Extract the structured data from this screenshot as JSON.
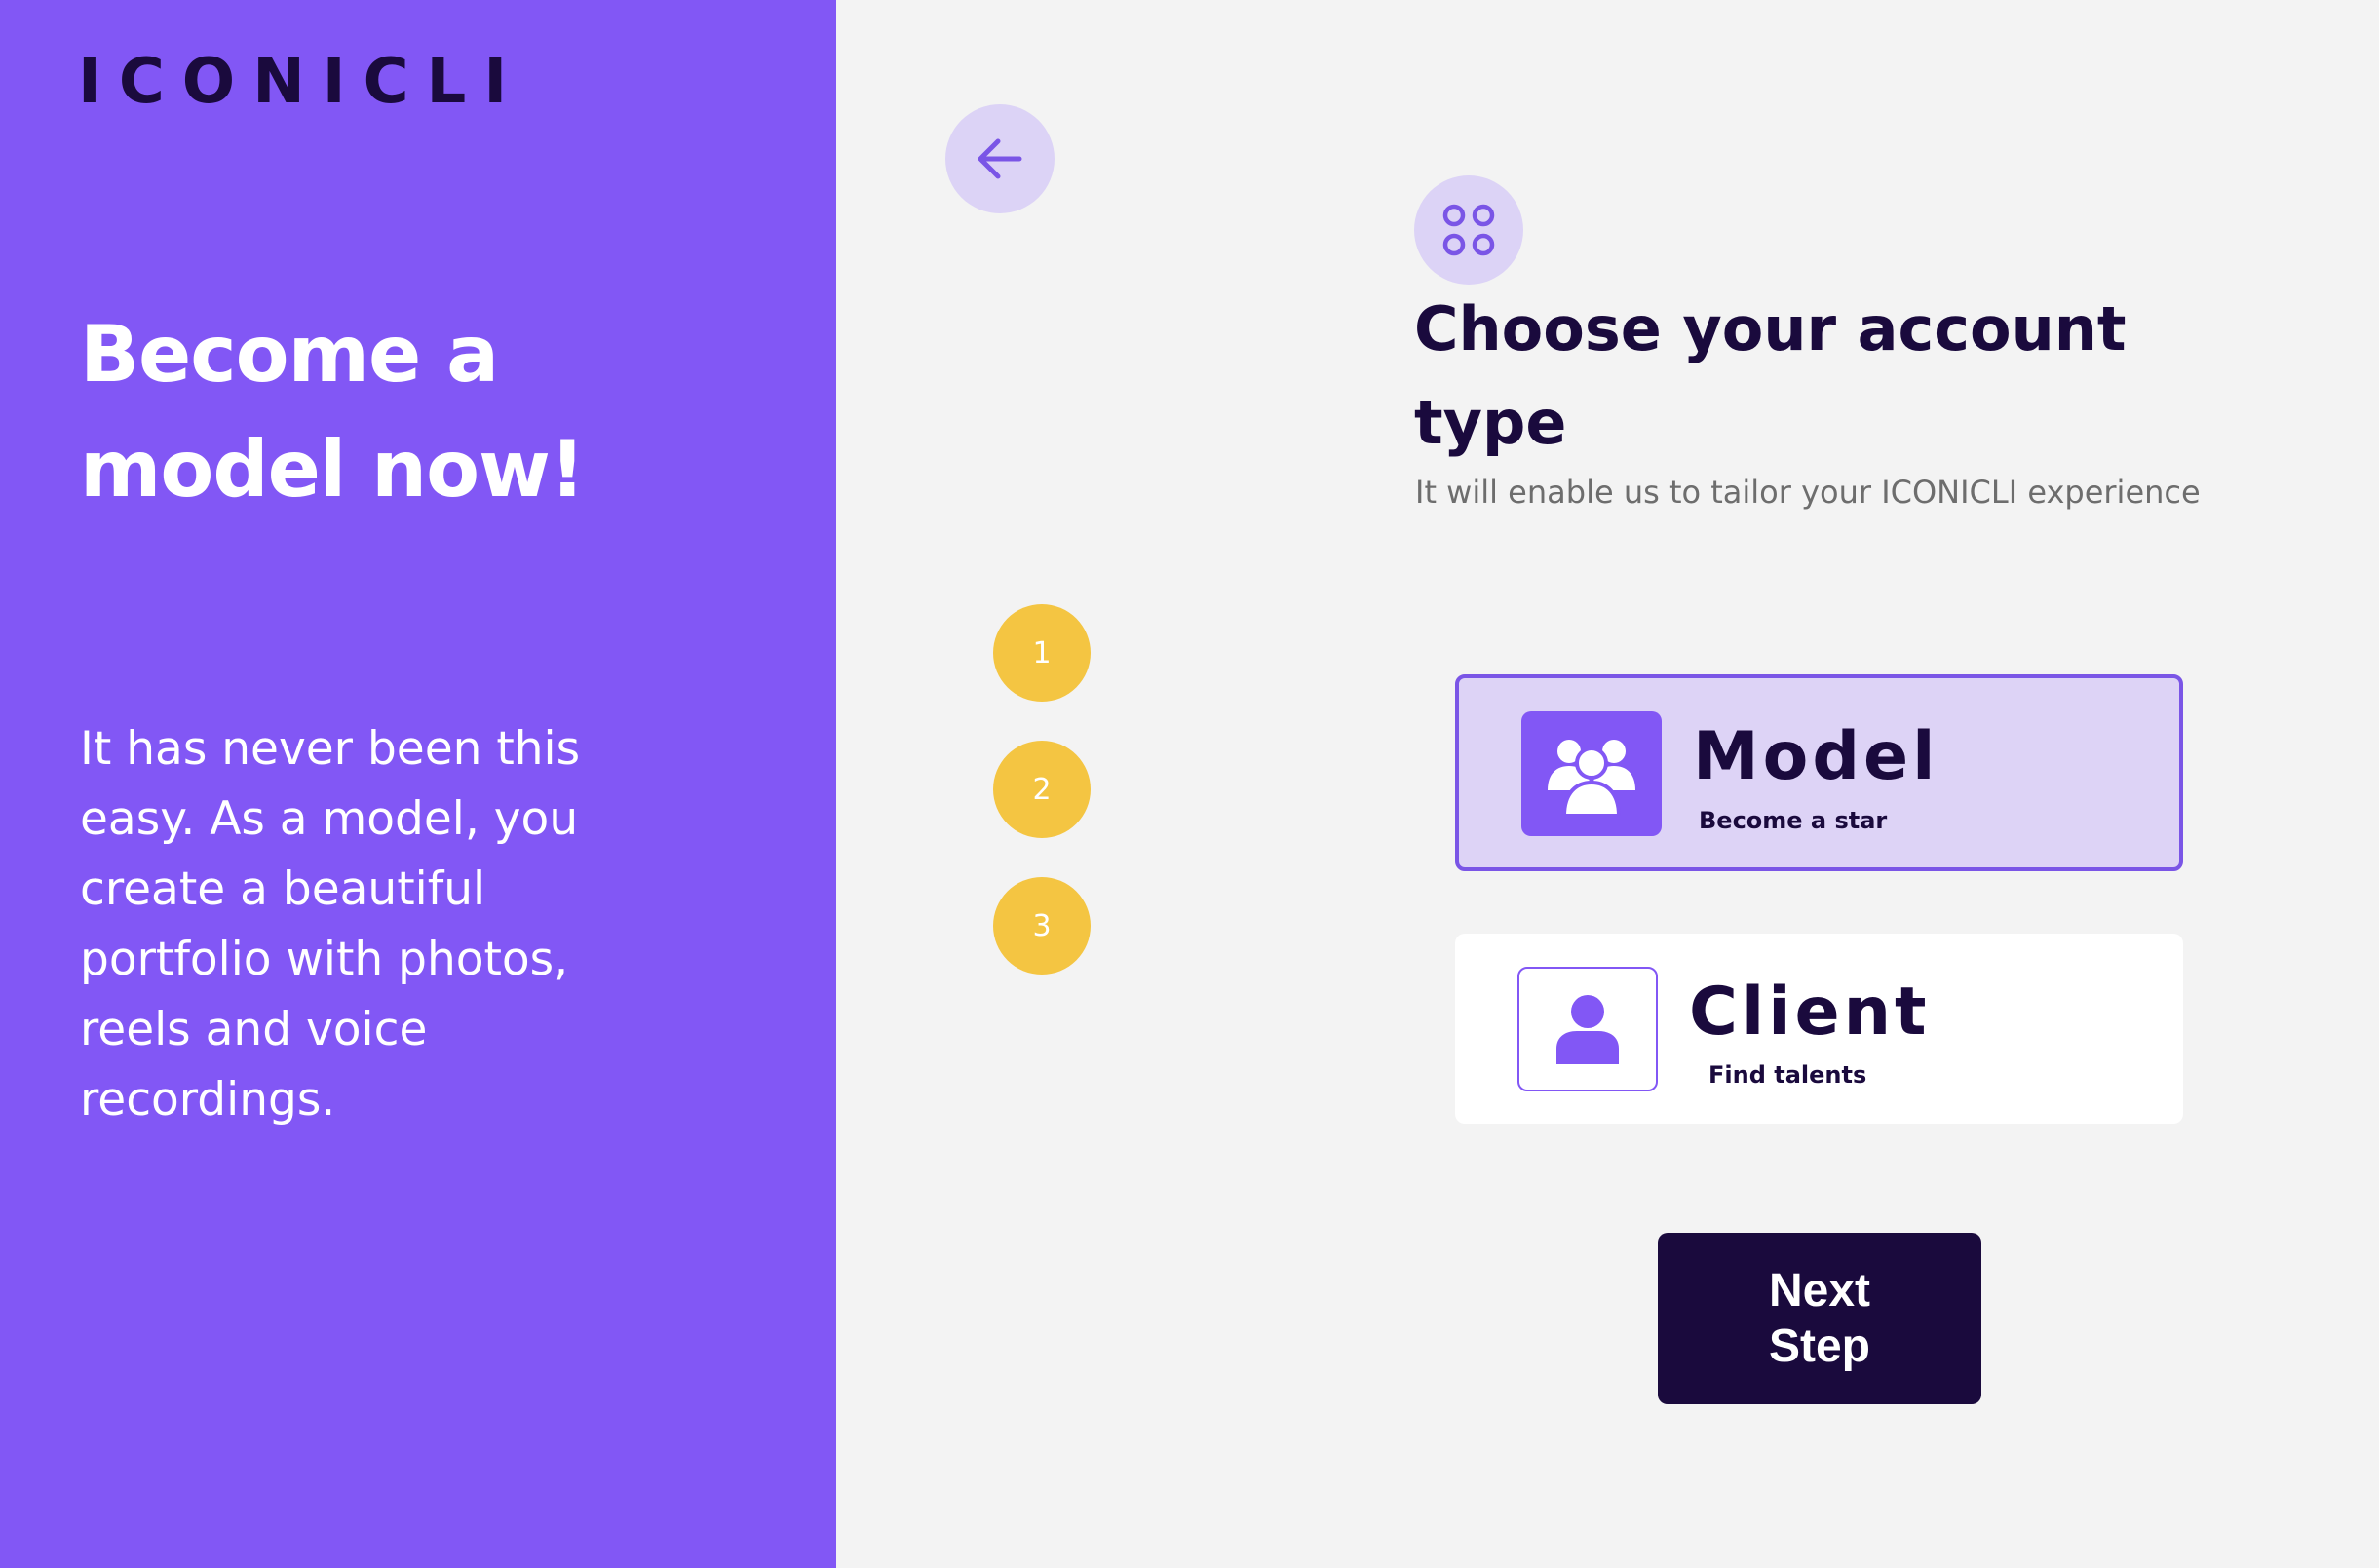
{
  "brand": {
    "logo_text": "ICONICLI",
    "accent_color": "#8257f5",
    "dark_color": "#1a0a3d",
    "step_color": "#f4c542"
  },
  "left_panel": {
    "title": "Become a model now!",
    "description": "It has never been this easy. As a model, you create a beautiful portfolio with photos, reels and voice recordings."
  },
  "navigation": {
    "back_icon": "arrow-left-icon"
  },
  "steps": [
    {
      "label": "1"
    },
    {
      "label": "2"
    },
    {
      "label": "3"
    }
  ],
  "header": {
    "icon": "grid-circles-icon",
    "title": "Choose your account type",
    "subtitle": "It will enable us to tailor your ICONICLI experience"
  },
  "account_types": [
    {
      "title": "Model",
      "subtitle": "Become a star",
      "icon": "users-group-icon",
      "selected": true
    },
    {
      "title": "Client",
      "subtitle": "Find talents",
      "icon": "user-icon",
      "selected": false
    }
  ],
  "actions": {
    "next_label": "Next Step"
  }
}
